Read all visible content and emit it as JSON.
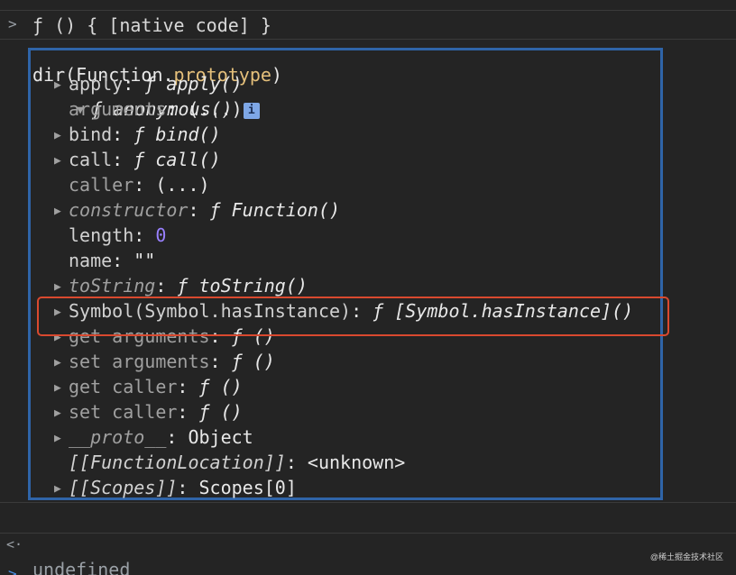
{
  "console": {
    "top_partial": "ƒ () { [native code] }",
    "input": {
      "prompt": ">",
      "prefix": "dir(Function.",
      "highlight": "prototype",
      "suffix": ")"
    },
    "root": {
      "arrow": "▼",
      "f": "ƒ",
      "label": "anonymous()",
      "info": "i"
    },
    "properties": [
      {
        "key": "apply",
        "sep": ": ",
        "f": "ƒ ",
        "value": "apply()"
      },
      {
        "key": "arguments",
        "sep": ": ",
        "value": "(...)"
      },
      {
        "key": "bind",
        "sep": ": ",
        "f": "ƒ ",
        "value": "bind()"
      },
      {
        "key": "call",
        "sep": ": ",
        "f": "ƒ ",
        "value": "call()"
      },
      {
        "key": "caller",
        "sep": ": ",
        "value": "(...)"
      },
      {
        "key": "constructor",
        "sep": ": ",
        "f": "ƒ ",
        "value": "Function()"
      },
      {
        "key": "length",
        "sep": ": ",
        "value": "0"
      },
      {
        "key": "name",
        "sep": ": ",
        "value": "\"\""
      },
      {
        "key": "toString",
        "sep": ": ",
        "f": "ƒ ",
        "value": "toString()"
      },
      {
        "key": "Symbol(Symbol.hasInstance)",
        "sep": ": ",
        "f": "ƒ ",
        "value": "[Symbol.hasInstance]()"
      },
      {
        "key": "get arguments",
        "sep": ": ",
        "f": "ƒ ",
        "value": "()"
      },
      {
        "key": "set arguments",
        "sep": ": ",
        "f": "ƒ ",
        "value": "()"
      },
      {
        "key": "get caller",
        "sep": ": ",
        "f": "ƒ ",
        "value": "()"
      },
      {
        "key": "set caller",
        "sep": ": ",
        "f": "ƒ ",
        "value": "()"
      },
      {
        "key": "__proto__",
        "sep": ": ",
        "value": "Object"
      },
      {
        "key": "[[FunctionLocation]]",
        "sep": ": ",
        "value": "<unknown>"
      },
      {
        "key": "[[Scopes]]",
        "sep": ": ",
        "value": "Scopes[0]"
      }
    ],
    "result": {
      "prompt": "<·",
      "value": "undefined"
    },
    "next_prompt": ">"
  },
  "watermark": "@稀土掘金技术社区",
  "colors": {
    "background": "#242424",
    "highlight_box": "#2f64a8",
    "emphasis_box": "#d9492f",
    "number": "#9980ff",
    "keyword": "#e5c07b"
  }
}
